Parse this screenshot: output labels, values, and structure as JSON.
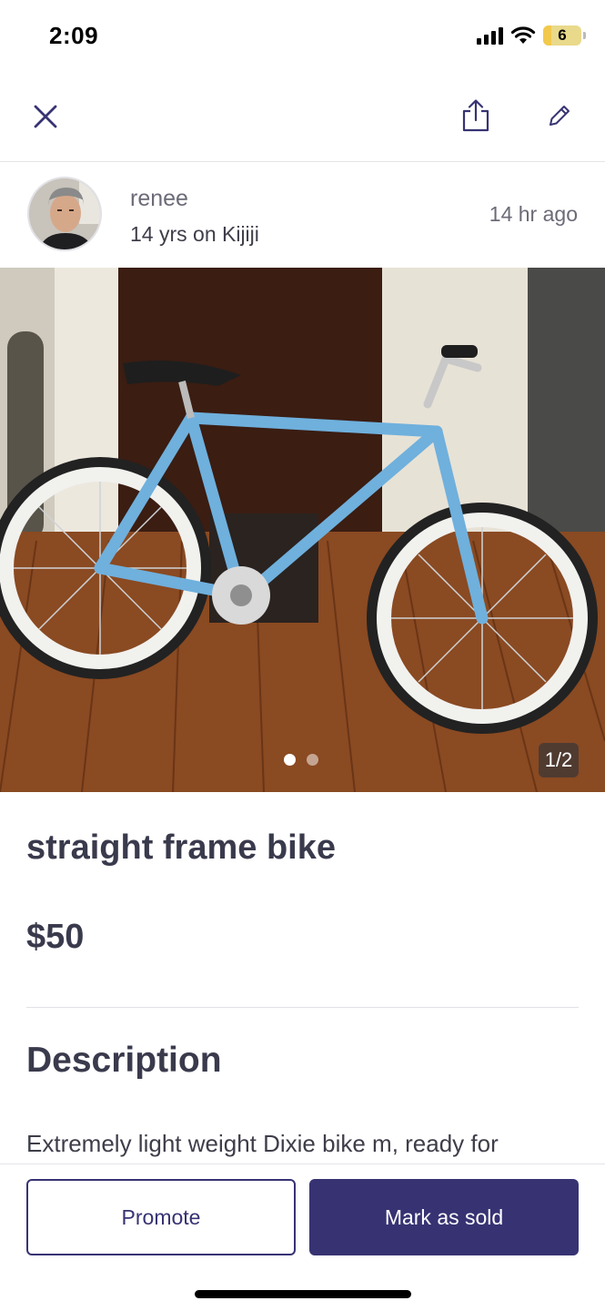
{
  "status_bar": {
    "time": "2:09",
    "battery_level": "6"
  },
  "nav": {
    "close_icon": "close-icon",
    "share_icon": "share-icon",
    "edit_icon": "edit-pencil-icon"
  },
  "seller": {
    "name": "renee",
    "tenure": "14 yrs on Kijiji",
    "posted": "14 hr  ago"
  },
  "gallery": {
    "counter": "1/2",
    "current_index": 1,
    "total": 2
  },
  "listing": {
    "title": "straight frame bike",
    "price": "$50",
    "description_heading": "Description",
    "description_text": "Extremely light weight Dixie bike m, ready for"
  },
  "actions": {
    "promote_label": "Promote",
    "mark_sold_label": "Mark as sold"
  },
  "colors": {
    "brand": "#373373",
    "text_primary": "#3a3a4d",
    "text_muted": "#6b6b78"
  }
}
